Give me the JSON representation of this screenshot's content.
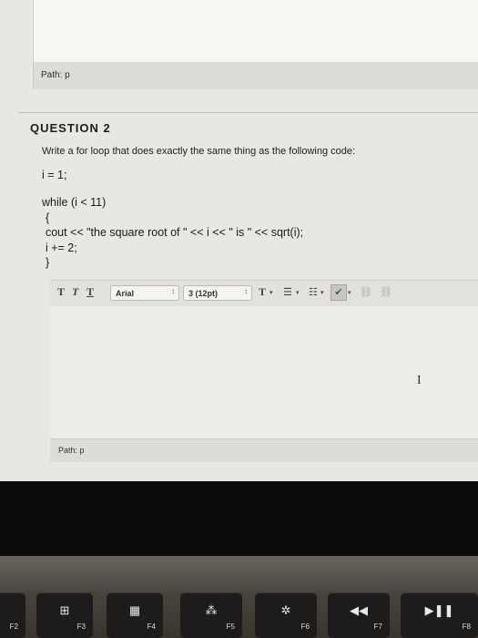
{
  "top_path": {
    "label": "Path: p"
  },
  "question": {
    "title": "QUESTION 2",
    "prompt": "Write a for loop that does exactly the same thing as the following code:",
    "code_lines": [
      "i = 1;",
      "while (i < 11)",
      "  {",
      "  cout << \"the square root of \" << i << \" is \" << sqrt(i);",
      "  i += 2;",
      "  }"
    ]
  },
  "toolbar": {
    "bold": "T",
    "italic": "T",
    "underline": "T",
    "font_family": "Arial",
    "font_size": "3 (12pt)",
    "text_color": "T",
    "select_arrows": "↕"
  },
  "editor": {
    "value": ""
  },
  "bottom_path": {
    "label": "Path: p"
  },
  "keyboard": {
    "keys": [
      {
        "label": "F2"
      },
      {
        "label": "F3"
      },
      {
        "label": "F4"
      },
      {
        "label": "F5"
      },
      {
        "label": "F6"
      },
      {
        "label": "F7"
      },
      {
        "label": "F8"
      }
    ]
  }
}
